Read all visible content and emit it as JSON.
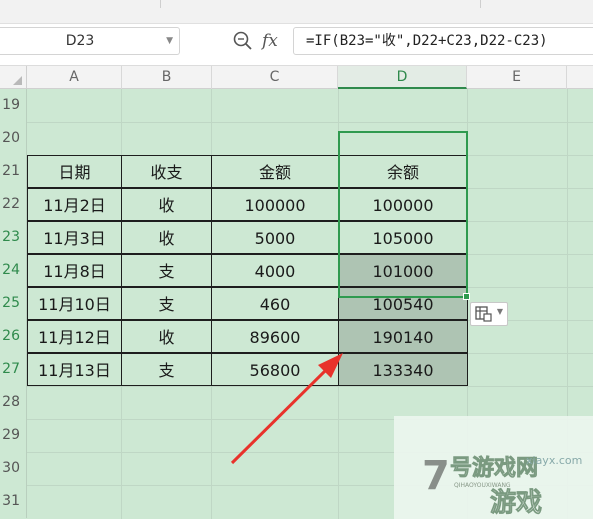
{
  "formula_bar": {
    "name_box": "D23",
    "formula": "=IF(B23=\"收\",D22+C23,D22-C23)",
    "zoom_icon": "magnifier-icon",
    "fx_label": "fx"
  },
  "columns": [
    "A",
    "B",
    "C",
    "D",
    "E"
  ],
  "selected_column": "D",
  "rows": [
    "19",
    "20",
    "21",
    "22",
    "23",
    "24",
    "25",
    "26",
    "27",
    "28",
    "29",
    "30",
    "31"
  ],
  "table": {
    "headers": [
      "日期",
      "收支",
      "金额",
      "余额"
    ],
    "records": [
      {
        "date": "11月2日",
        "type": "收",
        "amount": "100000",
        "balance": "100000"
      },
      {
        "date": "11月3日",
        "type": "收",
        "amount": "5000",
        "balance": "105000"
      },
      {
        "date": "11月8日",
        "type": "支",
        "amount": "4000",
        "balance": "101000"
      },
      {
        "date": "11月10日",
        "type": "支",
        "amount": "460",
        "balance": "100540"
      },
      {
        "date": "11月12日",
        "type": "收",
        "amount": "89600",
        "balance": "190140"
      },
      {
        "date": "11月13日",
        "type": "支",
        "amount": "56800",
        "balance": "133340"
      }
    ]
  },
  "paste_options_icon": "paste-options-icon",
  "annotation_arrow_color": "#e8322b",
  "grid_color": "#cde8d3",
  "selection_color": "#2f9a4f",
  "watermark": {
    "logo_text": "7号游戏网",
    "logo_sub": "QIHAOYOUXIWANG",
    "big_text": "游戏",
    "site": "xiayx.com"
  }
}
